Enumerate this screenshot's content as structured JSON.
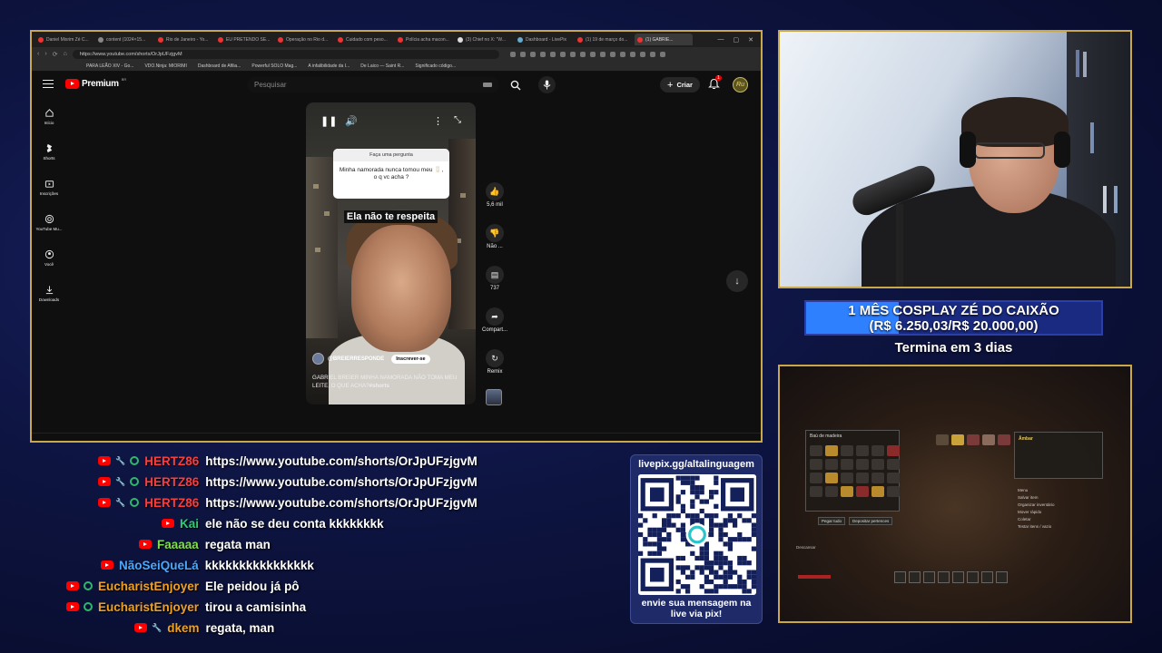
{
  "browser": {
    "tabs": [
      {
        "title": "Daniel Mixrim Zé C...",
        "icon": "youtube"
      },
      {
        "title": "content (1024×15...",
        "icon": "globe"
      },
      {
        "title": "Rio de Janeiro - Yo...",
        "icon": "youtube"
      },
      {
        "title": "EU PRETENDO SE...",
        "icon": "youtube"
      },
      {
        "title": "Operação no Rio d...",
        "icon": "youtube"
      },
      {
        "title": "Cuidado com peso...",
        "icon": "youtube"
      },
      {
        "title": "Polícia acha macon...",
        "icon": "news"
      },
      {
        "title": "(3) Chief no X: \"W...",
        "icon": "x"
      },
      {
        "title": "Dashboard - LivePix",
        "icon": "livepix"
      },
      {
        "title": "(1) 19 de março do...",
        "icon": "youtube"
      },
      {
        "title": "(1) GABRIE...",
        "icon": "youtube",
        "active": true
      }
    ],
    "url": "https://www.youtube.com/shorts/OrJpUFzjgvM",
    "bookmarks": [
      "PARA LEÃO XIV - Go...",
      "VDO.Ninja: MIORIMI",
      "Dashboard de Afilia...",
      "Powerful SOLO Mag...",
      "A infalibilidade da I...",
      "De Laico — Saint R...",
      "Significado código..."
    ]
  },
  "youtube": {
    "logo_text": "Premium",
    "logo_region": "BR",
    "search_placeholder": "Pesquisar",
    "create_label": "Criar",
    "notif_count": "1",
    "avatar_letter": "Ru",
    "nav": [
      {
        "label": "Início",
        "icon": "home-icon"
      },
      {
        "label": "Shorts",
        "icon": "shorts-icon"
      },
      {
        "label": "Inscrições",
        "icon": "subscriptions-icon"
      },
      {
        "label": "YouTube Mu...",
        "icon": "youtube-music-icon"
      },
      {
        "label": "Você",
        "icon": "you-icon"
      },
      {
        "label": "Downloads",
        "icon": "download-icon"
      }
    ],
    "short": {
      "question_header": "Faça uma pergunta",
      "question_text": "Minha namorada nunca tomou meu 🥛, o q vc acha ?",
      "caption": "Ela não te respeita",
      "channel": "@BREIERRESPONDE",
      "subscribe_label": "Inscrever-se",
      "title": "GABRIEL BREIER MINHA NAMORADA NÃO TOMA MEU LEITE, O QUE ACHA?",
      "hashtag": "#shorts"
    },
    "actions": [
      {
        "label": "5,6 mil",
        "icon": "like-icon"
      },
      {
        "label": "Não ...",
        "icon": "dislike-icon"
      },
      {
        "label": "737",
        "icon": "comment-icon"
      },
      {
        "label": "Compart...",
        "icon": "share-icon"
      },
      {
        "label": "Remix",
        "icon": "remix-icon"
      }
    ]
  },
  "goal": {
    "title": "1 MÊS COSPLAY ZÉ DO CAIXÃO",
    "amount": "(R$ 6.250,03/R$ 20.000,00)",
    "progress": 0.3125,
    "ends": "Termina em 3 dias"
  },
  "chat": [
    {
      "user": "HERTZ86",
      "color": "#ff3b3b",
      "badges": [
        "youtube",
        "wrench",
        "mod"
      ],
      "text": "https://www.youtube.com/shorts/OrJpUFzjgvM"
    },
    {
      "user": "HERTZ86",
      "color": "#ff3b3b",
      "badges": [
        "youtube",
        "wrench",
        "mod"
      ],
      "text": "https://www.youtube.com/shorts/OrJpUFzjgvM"
    },
    {
      "user": "HERTZ86",
      "color": "#ff3b3b",
      "badges": [
        "youtube",
        "wrench",
        "mod"
      ],
      "text": "https://www.youtube.com/shorts/OrJpUFzjgvM"
    },
    {
      "user": "Kai",
      "color": "#2ecc71",
      "badges": [
        "youtube"
      ],
      "text": "ele não se deu conta kkkkkkkk"
    },
    {
      "user": "Faaaaa",
      "color": "#7ee04a",
      "badges": [
        "youtube"
      ],
      "text": "regata man"
    },
    {
      "user": "NãoSeiQueLá",
      "color": "#4aa8ff",
      "badges": [
        "youtube"
      ],
      "text": "kkkkkkkkkkkkkkkk"
    },
    {
      "user": "EucharistEnjoyer",
      "color": "#f0a020",
      "badges": [
        "youtube",
        "mod"
      ],
      "text": "Ele peidou já pô"
    },
    {
      "user": "EucharistEnjoyer",
      "color": "#f0a020",
      "badges": [
        "youtube",
        "mod"
      ],
      "text": "tirou a camisinha"
    },
    {
      "user": "dkem",
      "color": "#f0a020",
      "badges": [
        "youtube",
        "wrench"
      ],
      "text": "regata, man"
    }
  ],
  "qr": {
    "url": "livepix.gg/altalinguagem",
    "note_line1": "envie sua mensagem na",
    "note_line2": "live via pix!"
  },
  "game": {
    "inventory_title": "Baú de madeira",
    "button_take": "Pegar tudo",
    "button_deposit": "Depositar pertences",
    "item_title": "Âmbar",
    "item_menu": [
      "Menu",
      "Salvar item",
      "Organizar inventário",
      "Mover rápido",
      "Coletar",
      "Testar itens / vazio"
    ],
    "player_label": "Descansar"
  }
}
